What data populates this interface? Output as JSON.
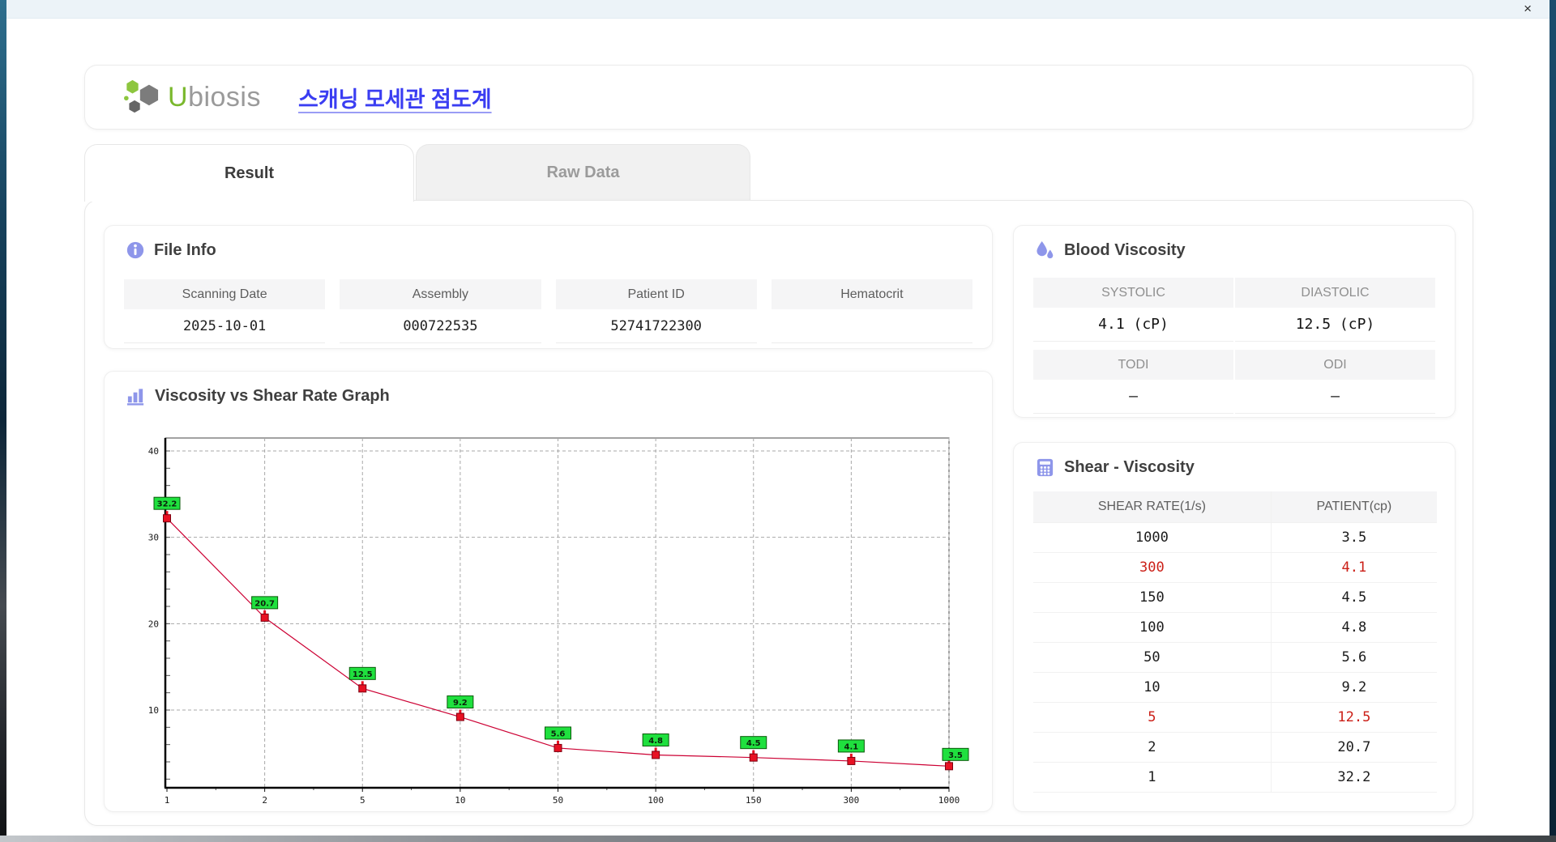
{
  "window": {
    "close_icon": "×"
  },
  "header": {
    "logo_text_u": "U",
    "logo_text_rest": "biosis",
    "title": "스캐닝 모세관 점도계"
  },
  "tabs": [
    {
      "label": "Result",
      "active": true
    },
    {
      "label": "Raw Data",
      "active": false
    }
  ],
  "file_info": {
    "title": "File Info",
    "fields": [
      {
        "label": "Scanning Date",
        "value": "2025-10-01"
      },
      {
        "label": "Assembly",
        "value": "000722535"
      },
      {
        "label": "Patient ID",
        "value": "52741722300"
      },
      {
        "label": "Hematocrit",
        "value": ""
      }
    ]
  },
  "blood_viscosity": {
    "title": "Blood Viscosity",
    "cells": [
      {
        "label": "SYSTOLIC",
        "value": "4.1 (cP)"
      },
      {
        "label": "DIASTOLIC",
        "value": "12.5 (cP)"
      },
      {
        "label": "TODI",
        "value": "–"
      },
      {
        "label": "ODI",
        "value": "–"
      }
    ]
  },
  "chart_data": {
    "type": "line",
    "title": "Viscosity vs Shear Rate Graph",
    "xlabel": "",
    "ylabel": "",
    "x": [
      1,
      2,
      5,
      10,
      50,
      100,
      150,
      300,
      1000
    ],
    "x_tick_labels": [
      "1",
      "2",
      "5",
      "10",
      "50",
      "100",
      "150",
      "300",
      "1000"
    ],
    "values": [
      32.2,
      20.7,
      12.5,
      9.2,
      5.6,
      4.8,
      4.5,
      4.1,
      3.5
    ],
    "y_ticks": [
      10,
      20,
      30,
      40
    ],
    "y_tick_labels": [
      "10",
      "20",
      "30",
      "40"
    ],
    "ylim": [
      1,
      41.5
    ],
    "x_axis_type": "categorical-log",
    "grid": true,
    "legend": "none",
    "line_color": "#cc0033",
    "marker_color": "#e81123",
    "marker_border": "#7d0010",
    "label_bg": "#1fe03e",
    "label_border": "#0a5a0a",
    "grid_color": "#a8a8a8"
  },
  "shear_table": {
    "title": "Shear - Viscosity",
    "columns": [
      "SHEAR RATE(1/s)",
      "PATIENT(cp)"
    ],
    "rows": [
      {
        "rate": "1000",
        "patient": "3.5",
        "highlight": false
      },
      {
        "rate": "300",
        "patient": "4.1",
        "highlight": true
      },
      {
        "rate": "150",
        "patient": "4.5",
        "highlight": false
      },
      {
        "rate": "100",
        "patient": "4.8",
        "highlight": false
      },
      {
        "rate": "50",
        "patient": "5.6",
        "highlight": false
      },
      {
        "rate": "10",
        "patient": "9.2",
        "highlight": false
      },
      {
        "rate": "5",
        "patient": "12.5",
        "highlight": true
      },
      {
        "rate": "2",
        "patient": "20.7",
        "highlight": false
      },
      {
        "rate": "1",
        "patient": "32.2",
        "highlight": false
      }
    ]
  }
}
